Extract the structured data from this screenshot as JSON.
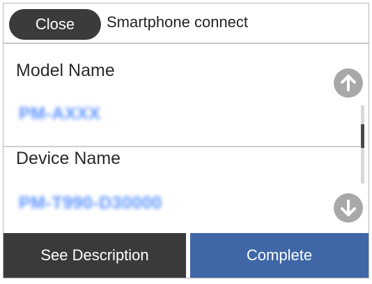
{
  "header": {
    "close_label": "Close",
    "title": "Smartphone connect"
  },
  "fields": [
    {
      "label": "Model Name",
      "value": "PM-AXXX"
    },
    {
      "label": "Device Name",
      "value": "PM-T990-D30000"
    }
  ],
  "scroll": {
    "up_icon": "arrow-up-icon",
    "down_icon": "arrow-down-icon",
    "thumb_position": 0.35,
    "thumb_fraction": 0.3
  },
  "footer": {
    "description_label": "See Description",
    "complete_label": "Complete"
  },
  "colors": {
    "close_button": "#3b3b3b",
    "value_text": "#5d93ff",
    "complete_button": "#3f66a6",
    "description_button": "#3a3a3a",
    "scroll_button": "#a8a8a8"
  }
}
